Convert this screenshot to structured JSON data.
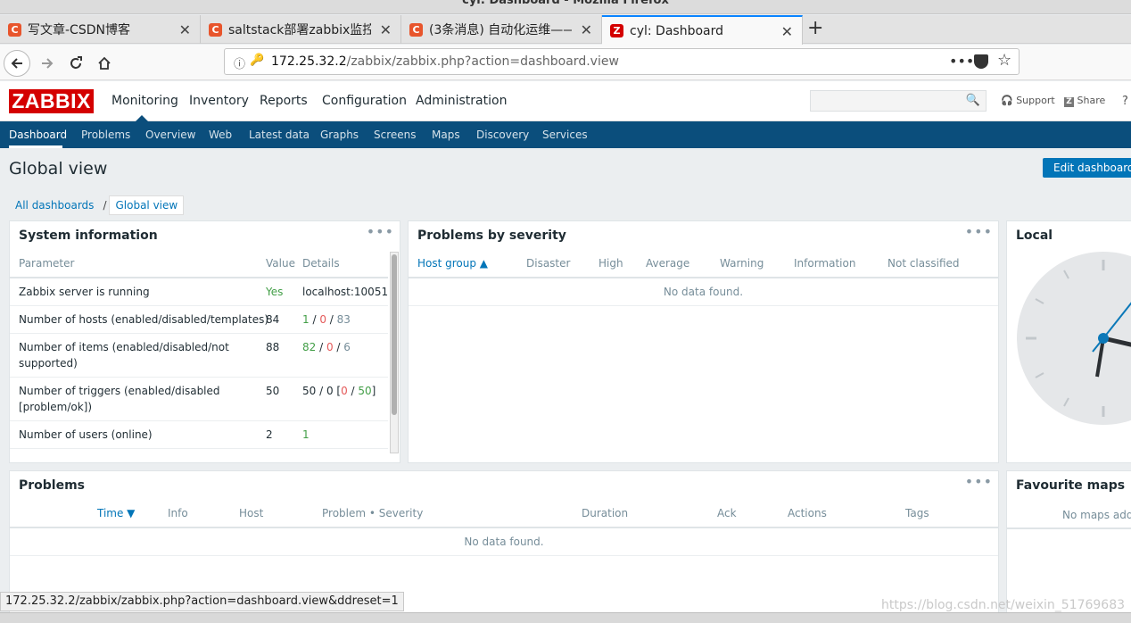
{
  "window": {
    "title": "cyl: Dashboard - Mozilla Firefox"
  },
  "browser": {
    "tabs": [
      {
        "label": "写文章-CSDN博客",
        "icon": "C"
      },
      {
        "label": "saltstack部署zabbix监控平",
        "icon": "C"
      },
      {
        "label": "(3条消息) 自动化运维——",
        "icon": "C"
      },
      {
        "label": "cyl: Dashboard",
        "icon": "Z"
      }
    ],
    "url_host": "172.25.32.2",
    "url_path": "/zabbix/zabbix.php?action=dashboard.view",
    "status_url": "172.25.32.2/zabbix/zabbix.php?action=dashboard.view&ddreset=1"
  },
  "header": {
    "logo": "ZABBIX",
    "menu": [
      "Monitoring",
      "Inventory",
      "Reports",
      "Configuration",
      "Administration"
    ],
    "support": "Support",
    "share": "Share",
    "help": "?"
  },
  "submenu": [
    "Dashboard",
    "Problems",
    "Overview",
    "Web",
    "Latest data",
    "Graphs",
    "Screens",
    "Maps",
    "Discovery",
    "Services"
  ],
  "page": {
    "title": "Global view",
    "edit_button": "Edit dashboard",
    "breadcrumb": [
      "All dashboards",
      "Global view"
    ]
  },
  "sysinfo": {
    "title": "System information",
    "headers": [
      "Parameter",
      "Value",
      "Details"
    ],
    "rows": [
      {
        "param": "Zabbix server is running",
        "value": "Yes",
        "details": "localhost:10051"
      },
      {
        "param": "Number of hosts (enabled/disabled/templates)",
        "value": "84",
        "d1": "1",
        "d2": "0",
        "d3": "83"
      },
      {
        "param": "Number of items (enabled/disabled/not supported)",
        "value": "88",
        "d1": "82",
        "d2": "0",
        "d3": "6"
      },
      {
        "param": "Number of triggers (enabled/disabled [problem/ok])",
        "value": "50",
        "dpre": "50 / 0 [",
        "d2": "0",
        "d3": "50",
        "dpost": "]"
      },
      {
        "param": "Number of users (online)",
        "value": "2",
        "d1": "1"
      }
    ]
  },
  "severity": {
    "title": "Problems by severity",
    "headers": [
      "Host group ▲",
      "Disaster",
      "High",
      "Average",
      "Warning",
      "Information",
      "Not classified"
    ],
    "empty": "No data found."
  },
  "local": {
    "title": "Local"
  },
  "problems": {
    "title": "Problems",
    "headers": [
      "Time ▼",
      "Info",
      "Host",
      "Problem • Severity",
      "Duration",
      "Ack",
      "Actions",
      "Tags"
    ],
    "empty": "No data found."
  },
  "favmaps": {
    "title": "Favourite maps",
    "empty": "No maps adde"
  },
  "watermark": "https://blog.csdn.net/weixin_51769683",
  "colors": {
    "brand": "#d40000",
    "nav": "#0b4e7c",
    "link": "#0275b8",
    "green": "#429e47",
    "red": "#e45959"
  }
}
